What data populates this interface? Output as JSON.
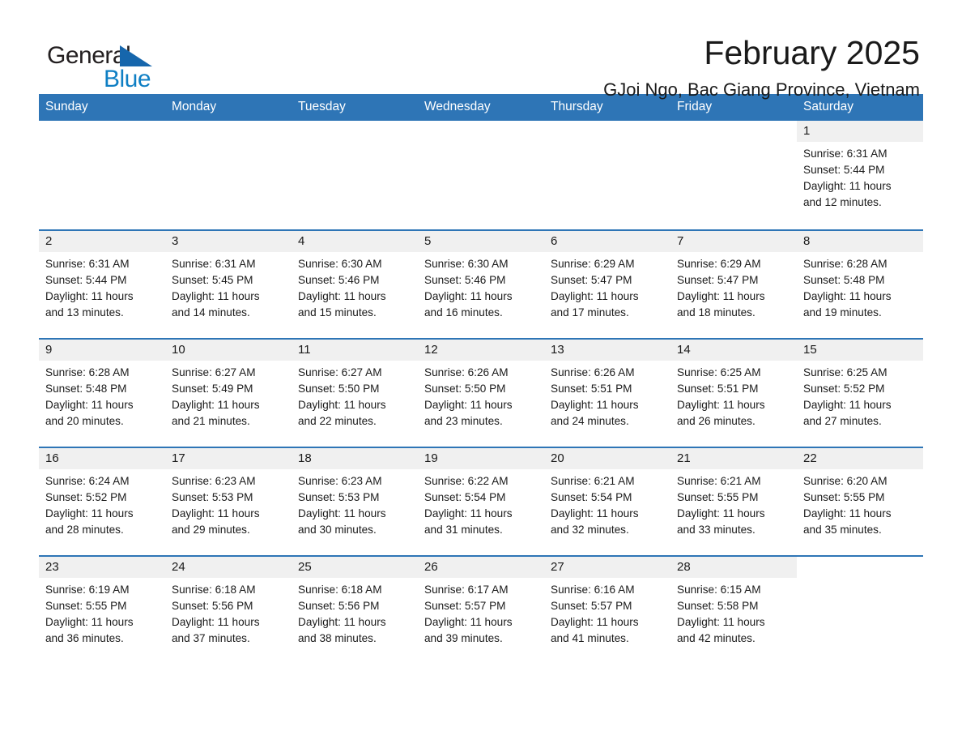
{
  "brand": {
    "name_top": "General",
    "name_bottom": "Blue",
    "accent_color": "#1666ac",
    "blue_text_color": "#0f7fc4"
  },
  "header": {
    "title": "February 2025",
    "subtitle": "GJoi Ngo, Bac Giang Province, Vietnam"
  },
  "calendar": {
    "header_bg": "#2e75b6",
    "row_divider_color": "#2e75b6",
    "day_band_bg": "#f0f0f0",
    "weekdays": [
      "Sunday",
      "Monday",
      "Tuesday",
      "Wednesday",
      "Thursday",
      "Friday",
      "Saturday"
    ],
    "weeks": [
      [
        {
          "day": "",
          "sunrise": "",
          "sunset": "",
          "daylight_line1": "",
          "daylight_line2": "",
          "blank": true
        },
        {
          "day": "",
          "sunrise": "",
          "sunset": "",
          "daylight_line1": "",
          "daylight_line2": "",
          "blank": true
        },
        {
          "day": "",
          "sunrise": "",
          "sunset": "",
          "daylight_line1": "",
          "daylight_line2": "",
          "blank": true
        },
        {
          "day": "",
          "sunrise": "",
          "sunset": "",
          "daylight_line1": "",
          "daylight_line2": "",
          "blank": true
        },
        {
          "day": "",
          "sunrise": "",
          "sunset": "",
          "daylight_line1": "",
          "daylight_line2": "",
          "blank": true
        },
        {
          "day": "",
          "sunrise": "",
          "sunset": "",
          "daylight_line1": "",
          "daylight_line2": "",
          "blank": true
        },
        {
          "day": "1",
          "sunrise": "Sunrise: 6:31 AM",
          "sunset": "Sunset: 5:44 PM",
          "daylight_line1": "Daylight: 11 hours",
          "daylight_line2": "and 12 minutes.",
          "blank": false
        }
      ],
      [
        {
          "day": "2",
          "sunrise": "Sunrise: 6:31 AM",
          "sunset": "Sunset: 5:44 PM",
          "daylight_line1": "Daylight: 11 hours",
          "daylight_line2": "and 13 minutes.",
          "blank": false
        },
        {
          "day": "3",
          "sunrise": "Sunrise: 6:31 AM",
          "sunset": "Sunset: 5:45 PM",
          "daylight_line1": "Daylight: 11 hours",
          "daylight_line2": "and 14 minutes.",
          "blank": false
        },
        {
          "day": "4",
          "sunrise": "Sunrise: 6:30 AM",
          "sunset": "Sunset: 5:46 PM",
          "daylight_line1": "Daylight: 11 hours",
          "daylight_line2": "and 15 minutes.",
          "blank": false
        },
        {
          "day": "5",
          "sunrise": "Sunrise: 6:30 AM",
          "sunset": "Sunset: 5:46 PM",
          "daylight_line1": "Daylight: 11 hours",
          "daylight_line2": "and 16 minutes.",
          "blank": false
        },
        {
          "day": "6",
          "sunrise": "Sunrise: 6:29 AM",
          "sunset": "Sunset: 5:47 PM",
          "daylight_line1": "Daylight: 11 hours",
          "daylight_line2": "and 17 minutes.",
          "blank": false
        },
        {
          "day": "7",
          "sunrise": "Sunrise: 6:29 AM",
          "sunset": "Sunset: 5:47 PM",
          "daylight_line1": "Daylight: 11 hours",
          "daylight_line2": "and 18 minutes.",
          "blank": false
        },
        {
          "day": "8",
          "sunrise": "Sunrise: 6:28 AM",
          "sunset": "Sunset: 5:48 PM",
          "daylight_line1": "Daylight: 11 hours",
          "daylight_line2": "and 19 minutes.",
          "blank": false
        }
      ],
      [
        {
          "day": "9",
          "sunrise": "Sunrise: 6:28 AM",
          "sunset": "Sunset: 5:48 PM",
          "daylight_line1": "Daylight: 11 hours",
          "daylight_line2": "and 20 minutes.",
          "blank": false
        },
        {
          "day": "10",
          "sunrise": "Sunrise: 6:27 AM",
          "sunset": "Sunset: 5:49 PM",
          "daylight_line1": "Daylight: 11 hours",
          "daylight_line2": "and 21 minutes.",
          "blank": false
        },
        {
          "day": "11",
          "sunrise": "Sunrise: 6:27 AM",
          "sunset": "Sunset: 5:50 PM",
          "daylight_line1": "Daylight: 11 hours",
          "daylight_line2": "and 22 minutes.",
          "blank": false
        },
        {
          "day": "12",
          "sunrise": "Sunrise: 6:26 AM",
          "sunset": "Sunset: 5:50 PM",
          "daylight_line1": "Daylight: 11 hours",
          "daylight_line2": "and 23 minutes.",
          "blank": false
        },
        {
          "day": "13",
          "sunrise": "Sunrise: 6:26 AM",
          "sunset": "Sunset: 5:51 PM",
          "daylight_line1": "Daylight: 11 hours",
          "daylight_line2": "and 24 minutes.",
          "blank": false
        },
        {
          "day": "14",
          "sunrise": "Sunrise: 6:25 AM",
          "sunset": "Sunset: 5:51 PM",
          "daylight_line1": "Daylight: 11 hours",
          "daylight_line2": "and 26 minutes.",
          "blank": false
        },
        {
          "day": "15",
          "sunrise": "Sunrise: 6:25 AM",
          "sunset": "Sunset: 5:52 PM",
          "daylight_line1": "Daylight: 11 hours",
          "daylight_line2": "and 27 minutes.",
          "blank": false
        }
      ],
      [
        {
          "day": "16",
          "sunrise": "Sunrise: 6:24 AM",
          "sunset": "Sunset: 5:52 PM",
          "daylight_line1": "Daylight: 11 hours",
          "daylight_line2": "and 28 minutes.",
          "blank": false
        },
        {
          "day": "17",
          "sunrise": "Sunrise: 6:23 AM",
          "sunset": "Sunset: 5:53 PM",
          "daylight_line1": "Daylight: 11 hours",
          "daylight_line2": "and 29 minutes.",
          "blank": false
        },
        {
          "day": "18",
          "sunrise": "Sunrise: 6:23 AM",
          "sunset": "Sunset: 5:53 PM",
          "daylight_line1": "Daylight: 11 hours",
          "daylight_line2": "and 30 minutes.",
          "blank": false
        },
        {
          "day": "19",
          "sunrise": "Sunrise: 6:22 AM",
          "sunset": "Sunset: 5:54 PM",
          "daylight_line1": "Daylight: 11 hours",
          "daylight_line2": "and 31 minutes.",
          "blank": false
        },
        {
          "day": "20",
          "sunrise": "Sunrise: 6:21 AM",
          "sunset": "Sunset: 5:54 PM",
          "daylight_line1": "Daylight: 11 hours",
          "daylight_line2": "and 32 minutes.",
          "blank": false
        },
        {
          "day": "21",
          "sunrise": "Sunrise: 6:21 AM",
          "sunset": "Sunset: 5:55 PM",
          "daylight_line1": "Daylight: 11 hours",
          "daylight_line2": "and 33 minutes.",
          "blank": false
        },
        {
          "day": "22",
          "sunrise": "Sunrise: 6:20 AM",
          "sunset": "Sunset: 5:55 PM",
          "daylight_line1": "Daylight: 11 hours",
          "daylight_line2": "and 35 minutes.",
          "blank": false
        }
      ],
      [
        {
          "day": "23",
          "sunrise": "Sunrise: 6:19 AM",
          "sunset": "Sunset: 5:55 PM",
          "daylight_line1": "Daylight: 11 hours",
          "daylight_line2": "and 36 minutes.",
          "blank": false
        },
        {
          "day": "24",
          "sunrise": "Sunrise: 6:18 AM",
          "sunset": "Sunset: 5:56 PM",
          "daylight_line1": "Daylight: 11 hours",
          "daylight_line2": "and 37 minutes.",
          "blank": false
        },
        {
          "day": "25",
          "sunrise": "Sunrise: 6:18 AM",
          "sunset": "Sunset: 5:56 PM",
          "daylight_line1": "Daylight: 11 hours",
          "daylight_line2": "and 38 minutes.",
          "blank": false
        },
        {
          "day": "26",
          "sunrise": "Sunrise: 6:17 AM",
          "sunset": "Sunset: 5:57 PM",
          "daylight_line1": "Daylight: 11 hours",
          "daylight_line2": "and 39 minutes.",
          "blank": false
        },
        {
          "day": "27",
          "sunrise": "Sunrise: 6:16 AM",
          "sunset": "Sunset: 5:57 PM",
          "daylight_line1": "Daylight: 11 hours",
          "daylight_line2": "and 41 minutes.",
          "blank": false
        },
        {
          "day": "28",
          "sunrise": "Sunrise: 6:15 AM",
          "sunset": "Sunset: 5:58 PM",
          "daylight_line1": "Daylight: 11 hours",
          "daylight_line2": "and 42 minutes.",
          "blank": false
        },
        {
          "day": "",
          "sunrise": "",
          "sunset": "",
          "daylight_line1": "",
          "daylight_line2": "",
          "blank": true
        }
      ]
    ]
  }
}
